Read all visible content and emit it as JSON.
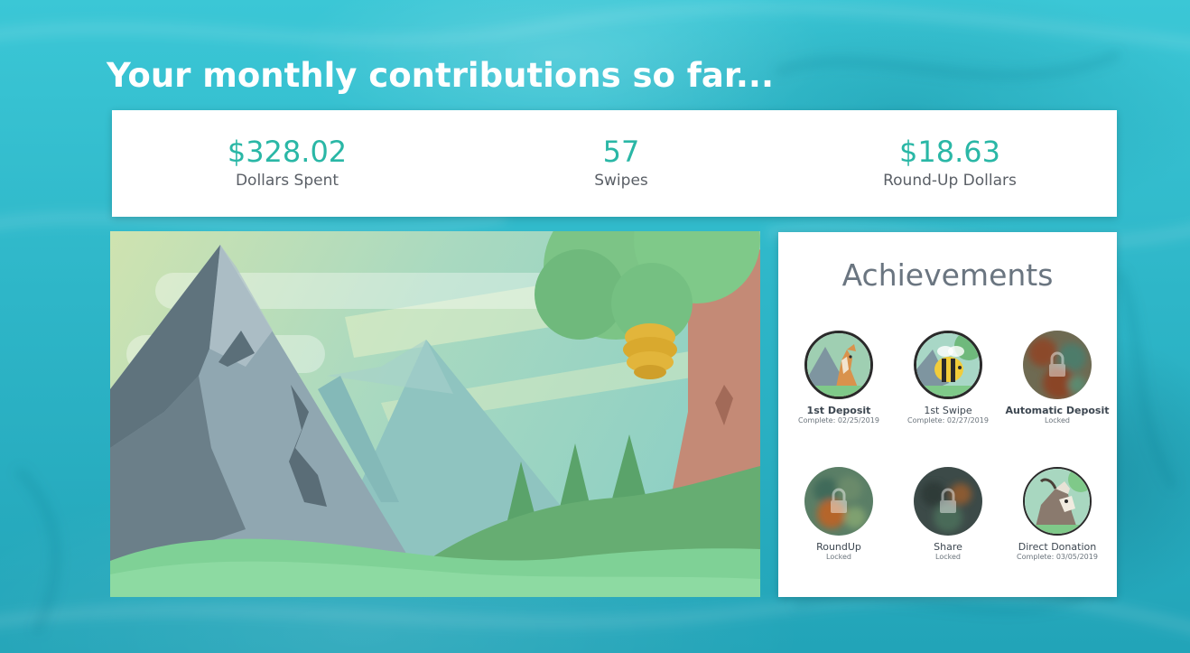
{
  "page": {
    "headline": "Your monthly contributions so far..."
  },
  "stats": [
    {
      "value": "$328.02",
      "label": "Dollars Spent"
    },
    {
      "value": "57",
      "label": "Swipes"
    },
    {
      "value": "$18.63",
      "label": "Round-Up Dollars"
    }
  ],
  "achievements": {
    "title": "Achievements",
    "items": [
      {
        "name": "1st Deposit",
        "status": "Complete: 02/25/2019",
        "state": "complete",
        "icon": "deer-icon"
      },
      {
        "name": "1st Swipe",
        "status": "Complete: 02/27/2019",
        "state": "complete",
        "icon": "bee-icon"
      },
      {
        "name": "Automatic Deposit",
        "status": "Locked",
        "state": "locked",
        "icon": "lock-icon"
      },
      {
        "name": "RoundUp",
        "status": "Locked",
        "state": "locked",
        "icon": "lock-icon"
      },
      {
        "name": "Share",
        "status": "Locked",
        "state": "locked",
        "icon": "lock-icon"
      },
      {
        "name": "Direct Donation",
        "status": "Complete: 03/05/2019",
        "state": "complete",
        "icon": "goat-icon"
      }
    ]
  },
  "colors": {
    "accent": "#2ab7a6",
    "background": "#2eb6c8",
    "card": "#ffffff",
    "label": "#5a5f66"
  }
}
